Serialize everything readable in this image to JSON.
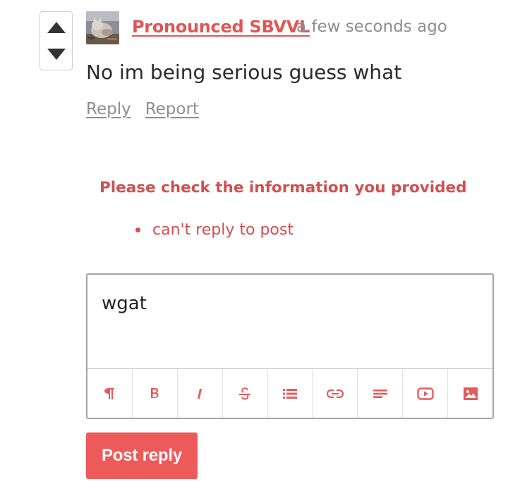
{
  "comment": {
    "author": "Pronounced SBVVL",
    "timestamp": "a few seconds ago",
    "body": "No im being serious guess what",
    "avatar_icon": "cat-avatar"
  },
  "actions": {
    "reply": "Reply",
    "report": "Report"
  },
  "vote": {
    "up_icon": "triangle-up-icon",
    "down_icon": "triangle-down-icon"
  },
  "errors": {
    "title": "Please check the information you provided",
    "items": [
      "can't reply to post"
    ]
  },
  "editor": {
    "value": "wgat",
    "toolbar": [
      {
        "name": "paragraph",
        "icon": "pilcrow-icon"
      },
      {
        "name": "bold",
        "icon": "bold-icon"
      },
      {
        "name": "italic",
        "icon": "italic-icon"
      },
      {
        "name": "strikethrough",
        "icon": "strikethrough-icon"
      },
      {
        "name": "list",
        "icon": "bullet-list-icon"
      },
      {
        "name": "link",
        "icon": "link-icon"
      },
      {
        "name": "align",
        "icon": "align-left-icon"
      },
      {
        "name": "video",
        "icon": "youtube-icon"
      },
      {
        "name": "image",
        "icon": "image-icon"
      }
    ]
  },
  "submit": {
    "label": "Post reply"
  },
  "colors": {
    "accent": "#e05656",
    "error": "#d05050",
    "button": "#ee5a5a",
    "muted": "#8e8e8e",
    "toolbar_icon": "#e85a5a"
  }
}
